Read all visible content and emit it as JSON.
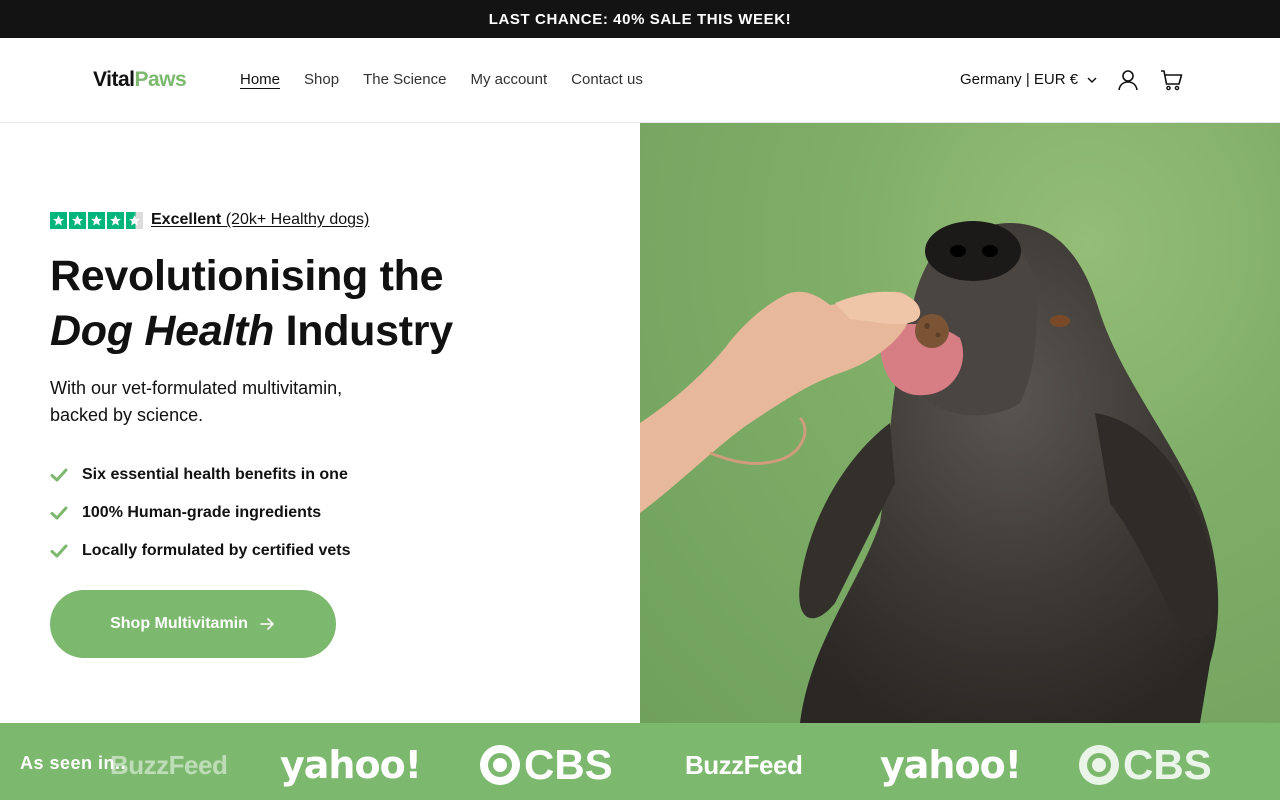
{
  "announcement": {
    "text": "LAST CHANCE: 40% SALE THIS WEEK!"
  },
  "header": {
    "logo": {
      "part1": "Vital",
      "part2": "Paws"
    },
    "nav": [
      "Home",
      "Shop",
      "The Science",
      "My account",
      "Contact us"
    ],
    "active_nav": "Home",
    "locale": "Germany | EUR €",
    "icons": [
      "chevron-down-icon",
      "account-icon",
      "cart-icon"
    ]
  },
  "hero": {
    "rating": {
      "label": "Excellent",
      "detail": "(20k+ Healthy dogs)",
      "stars": 4.5
    },
    "headline": {
      "line1": "Revolutionising the",
      "line2_italic": "Dog Health",
      "line2_rest": " Industry"
    },
    "subtext": "With our vet-formulated multivitamin, backed by science.",
    "benefits": [
      "Six essential health benefits in one",
      "100% Human-grade ingredients",
      "Locally formulated by certified vets"
    ],
    "cta": "Shop Multivitamin"
  },
  "press": {
    "label": "As seen in..",
    "logos": [
      "BuzzFeed",
      "yahoo!",
      "CBS",
      "BuzzFeed",
      "yahoo!",
      "CBS"
    ]
  },
  "colors": {
    "brand_green": "#7cb96f",
    "announcement_bg": "#131313",
    "trustpilot_green": "#00b67a"
  }
}
